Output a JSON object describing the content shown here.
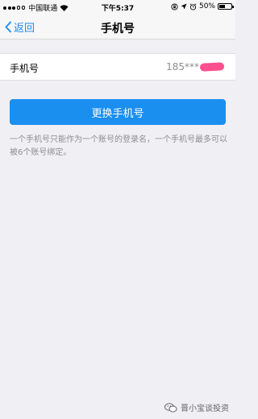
{
  "status_bar": {
    "carrier": "中国联通",
    "time": "下午5:37",
    "battery_percent_text": "50%",
    "battery_level": 0.5
  },
  "nav": {
    "back_label": "返回",
    "title": "手机号"
  },
  "phone": {
    "label": "手机号",
    "value": "185***"
  },
  "change_button_label": "更换手机号",
  "hint_text": "一个手机号只能作为一个账号的登录名，一个手机号最多可以被6个账号绑定。",
  "watermark_text": "晋小宝谈投资",
  "colors": {
    "accent": "#1a8ff0",
    "background": "#efeff4",
    "redaction": "#ff4f8e"
  }
}
